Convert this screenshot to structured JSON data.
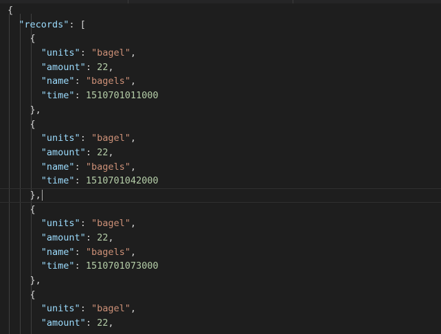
{
  "editor": {
    "lines": [
      {
        "indent": "",
        "tokens": [
          {
            "t": "punc",
            "v": "{"
          }
        ]
      },
      {
        "indent": "  ",
        "tokens": [
          {
            "t": "key",
            "v": "\"records\""
          },
          {
            "t": "punc",
            "v": ": ["
          }
        ]
      },
      {
        "indent": "    ",
        "tokens": [
          {
            "t": "punc",
            "v": "{"
          }
        ]
      },
      {
        "indent": "      ",
        "tokens": [
          {
            "t": "key",
            "v": "\"units\""
          },
          {
            "t": "punc",
            "v": ": "
          },
          {
            "t": "str",
            "v": "\"bagel\""
          },
          {
            "t": "punc",
            "v": ","
          }
        ]
      },
      {
        "indent": "      ",
        "tokens": [
          {
            "t": "key",
            "v": "\"amount\""
          },
          {
            "t": "punc",
            "v": ": "
          },
          {
            "t": "num",
            "v": "22"
          },
          {
            "t": "punc",
            "v": ","
          }
        ]
      },
      {
        "indent": "      ",
        "tokens": [
          {
            "t": "key",
            "v": "\"name\""
          },
          {
            "t": "punc",
            "v": ": "
          },
          {
            "t": "str",
            "v": "\"bagels\""
          },
          {
            "t": "punc",
            "v": ","
          }
        ]
      },
      {
        "indent": "      ",
        "tokens": [
          {
            "t": "key",
            "v": "\"time\""
          },
          {
            "t": "punc",
            "v": ": "
          },
          {
            "t": "num",
            "v": "1510701011000"
          }
        ]
      },
      {
        "indent": "    ",
        "tokens": [
          {
            "t": "punc",
            "v": "},"
          }
        ]
      },
      {
        "indent": "    ",
        "tokens": [
          {
            "t": "punc",
            "v": "{"
          }
        ]
      },
      {
        "indent": "      ",
        "tokens": [
          {
            "t": "key",
            "v": "\"units\""
          },
          {
            "t": "punc",
            "v": ": "
          },
          {
            "t": "str",
            "v": "\"bagel\""
          },
          {
            "t": "punc",
            "v": ","
          }
        ]
      },
      {
        "indent": "      ",
        "tokens": [
          {
            "t": "key",
            "v": "\"amount\""
          },
          {
            "t": "punc",
            "v": ": "
          },
          {
            "t": "num",
            "v": "22"
          },
          {
            "t": "punc",
            "v": ","
          }
        ]
      },
      {
        "indent": "      ",
        "tokens": [
          {
            "t": "key",
            "v": "\"name\""
          },
          {
            "t": "punc",
            "v": ": "
          },
          {
            "t": "str",
            "v": "\"bagels\""
          },
          {
            "t": "punc",
            "v": ","
          }
        ]
      },
      {
        "indent": "      ",
        "tokens": [
          {
            "t": "key",
            "v": "\"time\""
          },
          {
            "t": "punc",
            "v": ": "
          },
          {
            "t": "num",
            "v": "1510701042000"
          }
        ]
      },
      {
        "indent": "    ",
        "current": true,
        "tokens": [
          {
            "t": "punc",
            "v": "},"
          }
        ]
      },
      {
        "indent": "    ",
        "tokens": [
          {
            "t": "punc",
            "v": "{"
          }
        ]
      },
      {
        "indent": "      ",
        "tokens": [
          {
            "t": "key",
            "v": "\"units\""
          },
          {
            "t": "punc",
            "v": ": "
          },
          {
            "t": "str",
            "v": "\"bagel\""
          },
          {
            "t": "punc",
            "v": ","
          }
        ]
      },
      {
        "indent": "      ",
        "tokens": [
          {
            "t": "key",
            "v": "\"amount\""
          },
          {
            "t": "punc",
            "v": ": "
          },
          {
            "t": "num",
            "v": "22"
          },
          {
            "t": "punc",
            "v": ","
          }
        ]
      },
      {
        "indent": "      ",
        "tokens": [
          {
            "t": "key",
            "v": "\"name\""
          },
          {
            "t": "punc",
            "v": ": "
          },
          {
            "t": "str",
            "v": "\"bagels\""
          },
          {
            "t": "punc",
            "v": ","
          }
        ]
      },
      {
        "indent": "      ",
        "tokens": [
          {
            "t": "key",
            "v": "\"time\""
          },
          {
            "t": "punc",
            "v": ": "
          },
          {
            "t": "num",
            "v": "1510701073000"
          }
        ]
      },
      {
        "indent": "    ",
        "tokens": [
          {
            "t": "punc",
            "v": "},"
          }
        ]
      },
      {
        "indent": "    ",
        "tokens": [
          {
            "t": "punc",
            "v": "{"
          }
        ]
      },
      {
        "indent": "      ",
        "tokens": [
          {
            "t": "key",
            "v": "\"units\""
          },
          {
            "t": "punc",
            "v": ": "
          },
          {
            "t": "str",
            "v": "\"bagel\""
          },
          {
            "t": "punc",
            "v": ","
          }
        ]
      },
      {
        "indent": "      ",
        "tokens": [
          {
            "t": "key",
            "v": "\"amount\""
          },
          {
            "t": "punc",
            "v": ": "
          },
          {
            "t": "num",
            "v": "22"
          },
          {
            "t": "punc",
            "v": ","
          }
        ]
      }
    ]
  },
  "colors": {
    "background": "#1e1e1e",
    "key": "#9cdcfe",
    "string": "#ce9178",
    "number": "#b5cea8",
    "punctuation": "#d4d4d4"
  }
}
